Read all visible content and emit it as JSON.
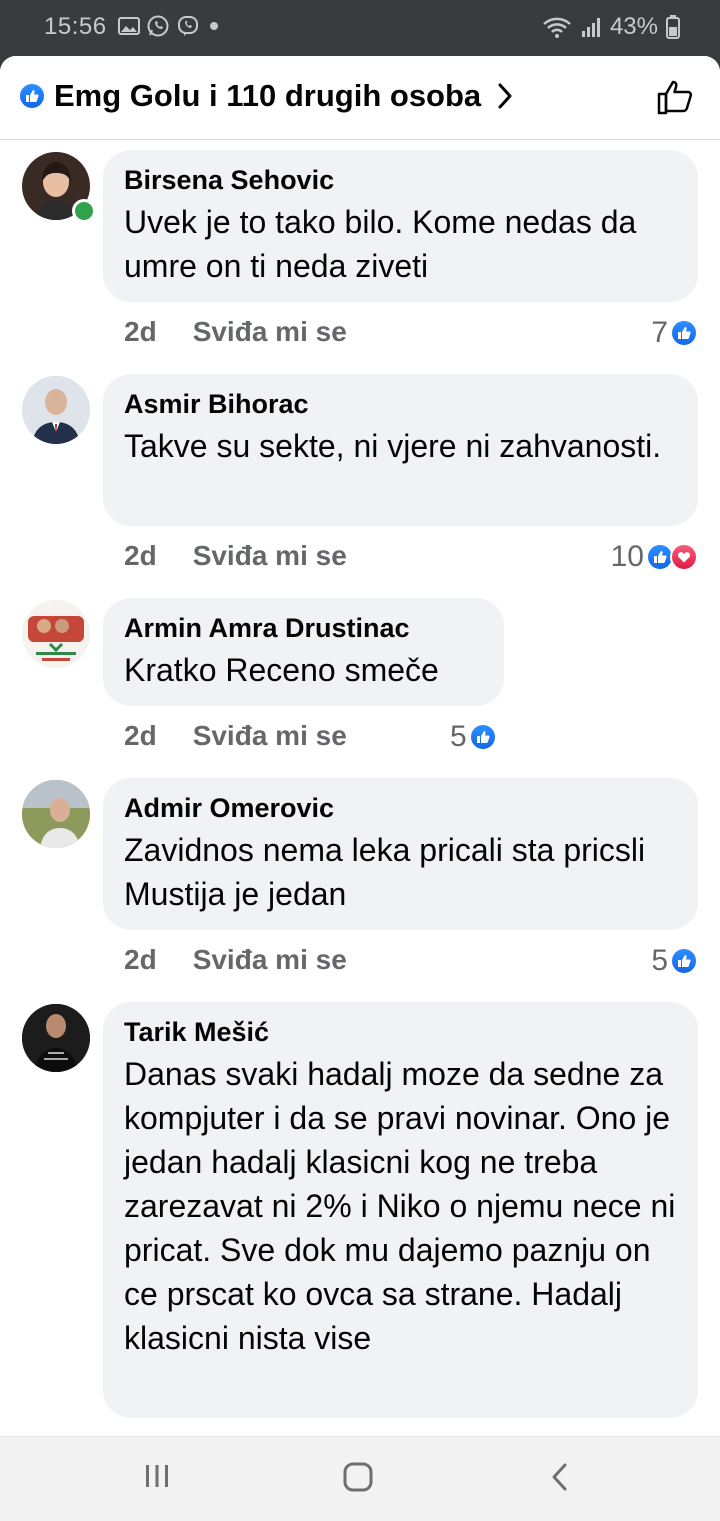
{
  "status_bar": {
    "time": "15:56",
    "battery": "43%",
    "left_icons": [
      "gallery-icon",
      "whatsapp-icon",
      "viber-icon",
      "dot-icon"
    ],
    "right_icons": [
      "wifi-icon",
      "signal-icon",
      "battery-icon"
    ]
  },
  "header": {
    "reactors_label": "Emg Golu i 110 drugih osoba"
  },
  "comments": [
    {
      "author": "Birsena Sehovic",
      "text": "Uvek je to tako bilo. Kome nedas da umre on ti neda ziveti",
      "time": "2d",
      "like_label": "Sviđa mi se",
      "reaction_count": "7",
      "reactions": [
        "like"
      ],
      "online": true
    },
    {
      "author": "Asmir Bihorac",
      "text": "Takve su sekte, ni vjere ni zahvanosti.",
      "time": "2d",
      "like_label": "Sviđa mi se",
      "reaction_count": "10",
      "reactions": [
        "like",
        "love"
      ],
      "online": false
    },
    {
      "author": "Armin Amra Drustinac",
      "text": "Kratko Receno smeče",
      "time": "2d",
      "like_label": "Sviđa mi se",
      "reaction_count": "5",
      "reactions": [
        "like"
      ],
      "online": false
    },
    {
      "author": "Admir Omerovic",
      "text": "Zavidnos nema leka pricali sta pricsli Mustija je jedan",
      "time": "2d",
      "like_label": "Sviđa mi se",
      "reaction_count": "5",
      "reactions": [
        "like"
      ],
      "online": false
    },
    {
      "author": "Tarik Mešić",
      "text": "Danas svaki hadalj moze da sedne za kompjuter i da se pravi novinar. Ono je jedan hadalj klasicni kog ne treba zarezavat ni 2% i Niko o njemu nece ni pricat. Sve dok mu dajemo paznju on ce prscat ko ovca sa strane. Hadalj klasicni nista vise",
      "online": false
    }
  ],
  "colors": {
    "like_blue": "#1877f2",
    "love_red": "#f33e58",
    "bubble_bg": "#f0f2f5",
    "meta_gray": "#65676b",
    "online_green": "#31a24c"
  },
  "nav_bar": {
    "buttons": [
      "recent-apps-icon",
      "home-icon",
      "back-icon"
    ]
  }
}
